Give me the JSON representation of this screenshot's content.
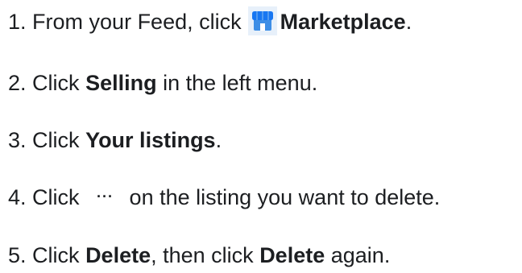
{
  "steps": [
    {
      "number": "1.",
      "before": "From your Feed, click",
      "icon": "marketplace-icon",
      "bold": "Marketplace",
      "after": "."
    },
    {
      "number": "2.",
      "before": "Click",
      "bold": "Selling",
      "after": "in the left menu."
    },
    {
      "number": "3.",
      "before": "Click",
      "bold": "Your listings",
      "after": "."
    },
    {
      "number": "4.",
      "before": "Click",
      "icon": "more-options-icon",
      "icon_glyph": "···",
      "after": "on the listing you want to delete."
    },
    {
      "number": "5.",
      "before": "Click",
      "bold": "Delete",
      "middle": ", then click",
      "bold2": "Delete",
      "after": "again."
    }
  ],
  "colors": {
    "text": "#1c1e21",
    "marketplace_icon_blue": "#3d8ee6",
    "marketplace_icon_dark": "#1877f2"
  }
}
